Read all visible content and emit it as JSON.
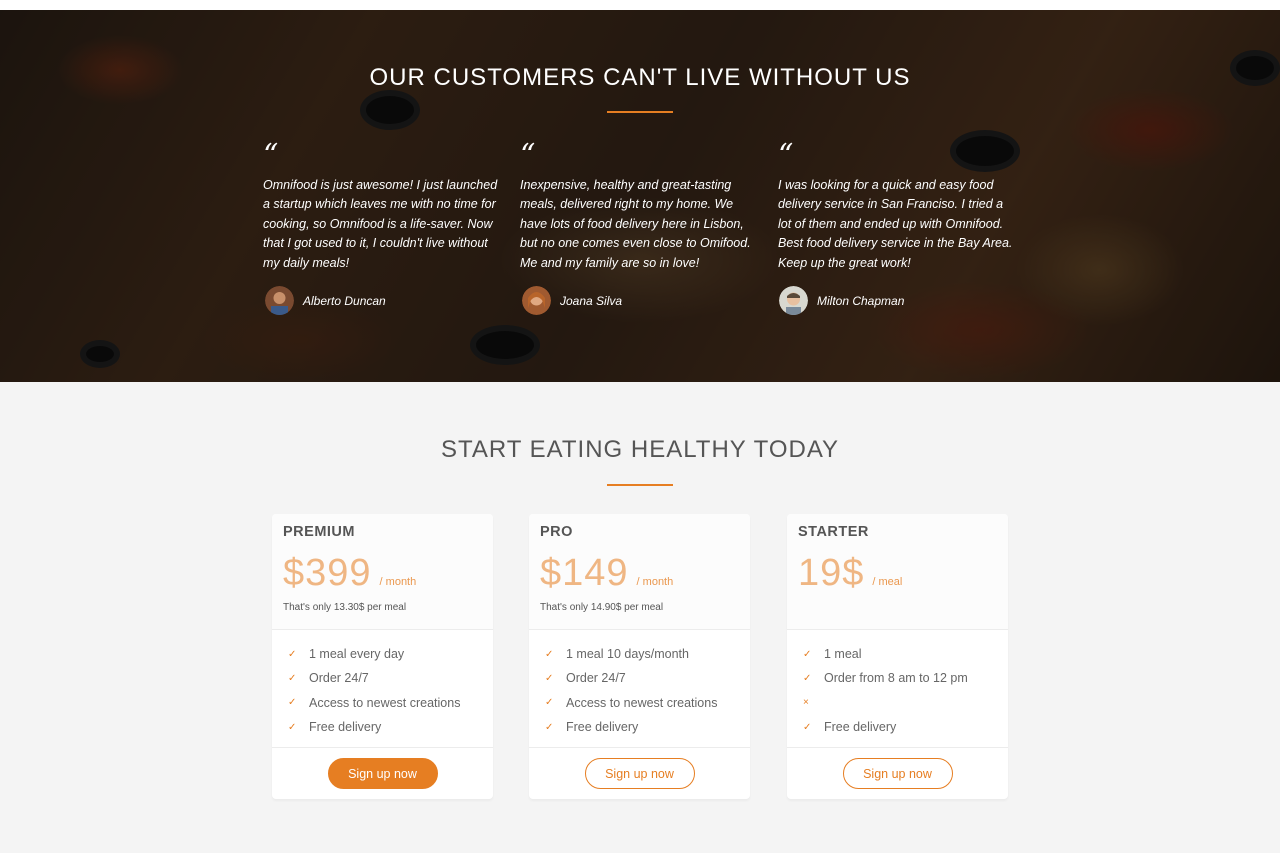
{
  "testimonials": {
    "title": "OUR CUSTOMERS CAN'T LIVE WITHOUT US",
    "quote_mark": "“",
    "items": [
      {
        "text": "Omnifood is just awesome! I just launched a startup which leaves me with no time for cooking, so Omnifood is a life-saver. Now that I got used to it, I couldn't live without my daily meals!",
        "name": "Alberto Duncan"
      },
      {
        "text": "Inexpensive, healthy and great-tasting meals, delivered right to my home. We have lots of food delivery here in Lisbon, but no one comes even close to Omifood. Me and my family are so in love!",
        "name": "Joana Silva"
      },
      {
        "text": "I was looking for a quick and easy food delivery service in San Franciso. I tried a lot of them and ended up with Omnifood. Best food delivery service in the Bay Area. Keep up the great work!",
        "name": "Milton Chapman"
      }
    ]
  },
  "plans": {
    "title": "START EATING HEALTHY TODAY",
    "check_mark": "✓",
    "cross_mark": "×",
    "items": [
      {
        "name": "PREMIUM",
        "price": "$399",
        "unit": "/ month",
        "per_meal": "That's only 13.30$ per meal",
        "features": [
          "1 meal every day",
          "Order 24/7",
          "Access to newest creations",
          "Free delivery"
        ],
        "button": "Sign up now"
      },
      {
        "name": "PRO",
        "price": "$149",
        "unit": "/ month",
        "per_meal": "That's only 14.90$ per meal",
        "features": [
          "1 meal 10 days/month",
          "Order 24/7",
          "Access to newest creations",
          "Free delivery"
        ],
        "button": "Sign up now"
      },
      {
        "name": "STARTER",
        "price": "19$",
        "unit": "/ meal",
        "per_meal": "",
        "features": [
          "1 meal",
          "Order from 8 am to 12 pm",
          "",
          "Free delivery"
        ],
        "button": "Sign up now"
      }
    ]
  },
  "colors": {
    "accent": "#e67e22",
    "section_bg": "#f4f4f4"
  }
}
